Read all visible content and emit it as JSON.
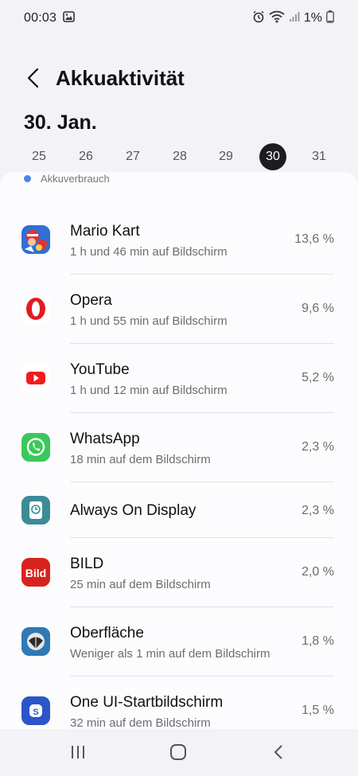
{
  "status": {
    "time": "00:03",
    "battery": "1%"
  },
  "header": {
    "title": "Akkuaktivität"
  },
  "date_title": "30. Jan.",
  "days": [
    "25",
    "26",
    "27",
    "28",
    "29",
    "30",
    "31"
  ],
  "selected_day": "30",
  "legend": {
    "label": "Akkuverbrauch",
    "color": "#4a86e8"
  },
  "apps": [
    {
      "name": "Mario Kart",
      "sub": "1 h und 46 min auf Bildschirm",
      "pct": "13,6 %"
    },
    {
      "name": "Opera",
      "sub": "1 h und 55 min auf Bildschirm",
      "pct": "9,6 %"
    },
    {
      "name": "YouTube",
      "sub": "1 h und 12 min auf Bildschirm",
      "pct": "5,2 %"
    },
    {
      "name": "WhatsApp",
      "sub": "18 min auf dem Bildschirm",
      "pct": "2,3 %"
    },
    {
      "name": "Always On Display",
      "sub": "",
      "pct": "2,3 %"
    },
    {
      "name": "BILD",
      "sub": "25 min auf dem Bildschirm",
      "pct": "2,0 %"
    },
    {
      "name": "Oberfläche",
      "sub": "Weniger als 1 min auf dem Bildschirm",
      "pct": "1,8 %"
    },
    {
      "name": "One UI-Startbildschirm",
      "sub": "32 min auf dem Bildschirm",
      "pct": "1,5 %"
    }
  ],
  "icons": {
    "status_left": [
      "image-icon"
    ],
    "status_right": [
      "alarm-icon",
      "wifi-icon",
      "signal-icon",
      "battery-icon"
    ],
    "apps": [
      "mario-kart-icon",
      "opera-icon",
      "youtube-icon",
      "whatsapp-icon",
      "always-on-display-icon",
      "bild-icon",
      "oberflaeche-icon",
      "one-ui-home-icon"
    ],
    "nav": [
      "recents-icon",
      "home-icon",
      "back-icon"
    ]
  }
}
